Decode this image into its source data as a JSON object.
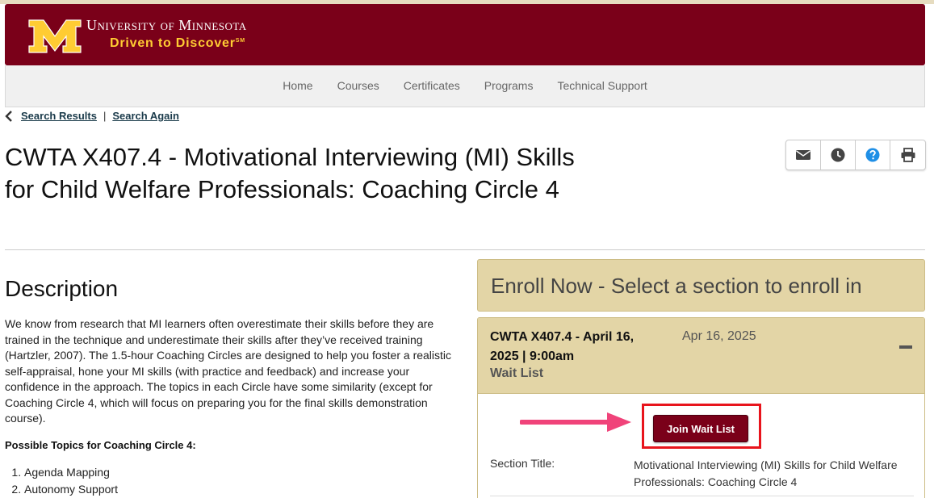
{
  "header": {
    "university_name": "University of Minnesota",
    "tagline": "Driven to Discover",
    "tagline_mark": "SM",
    "colors": {
      "maroon": "#7a0019",
      "gold": "#ffcc33"
    }
  },
  "nav": {
    "items": [
      "Home",
      "Courses",
      "Certificates",
      "Programs",
      "Technical Support"
    ]
  },
  "breadcrumb": {
    "search_results": "Search Results",
    "separator": "|",
    "search_again": "Search Again"
  },
  "course": {
    "title": "CWTA X407.4 - Motivational Interviewing (MI) Skills for Child Welfare Professionals: Coaching Circle 4"
  },
  "toolbar": {
    "icons": [
      "envelope-icon",
      "clock-icon",
      "help-icon",
      "print-icon"
    ]
  },
  "description": {
    "heading": "Description",
    "body": "We know from research that MI learners often overestimate their skills before they are trained in the technique and underestimate their skills after they’ve received training (Hartzler, 2007). The 1.5-hour Coaching Circles are designed to help you foster a realistic self-appraisal, hone your MI skills (with practice and feedback) and increase your confidence in the approach. The topics in each Circle have some similarity (except for Coaching Circle 4, which will focus on preparing you for the final skills demonstration course).",
    "topics_heading": "Possible Topics for Coaching Circle 4:",
    "topics": [
      "Agenda Mapping",
      "Autonomy Support"
    ]
  },
  "enroll": {
    "heading": "Enroll Now - Select a section to enroll in",
    "section": {
      "title": "CWTA X407.4 - April 16, 2025 | 9:00am",
      "status": "Wait List",
      "date": "Apr 16, 2025",
      "join_label": "Join Wait List",
      "section_title_label": "Section Title:",
      "section_title_value": "Motivational Interviewing (MI) Skills for Child Welfare Professionals: Coaching Circle 4"
    }
  }
}
